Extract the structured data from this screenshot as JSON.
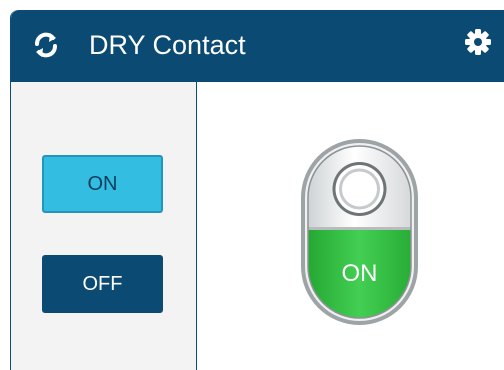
{
  "header": {
    "title": "DRY Contact",
    "refresh_icon": "refresh-icon",
    "settings_icon": "gear-icon",
    "color": "#0b4a72"
  },
  "controls": {
    "on_label": "ON",
    "off_label": "OFF",
    "on_color": "#33bde0",
    "off_color": "#0b4a72"
  },
  "status": {
    "switch_label": "ON",
    "state": "on",
    "on_color": "#38c14a"
  }
}
